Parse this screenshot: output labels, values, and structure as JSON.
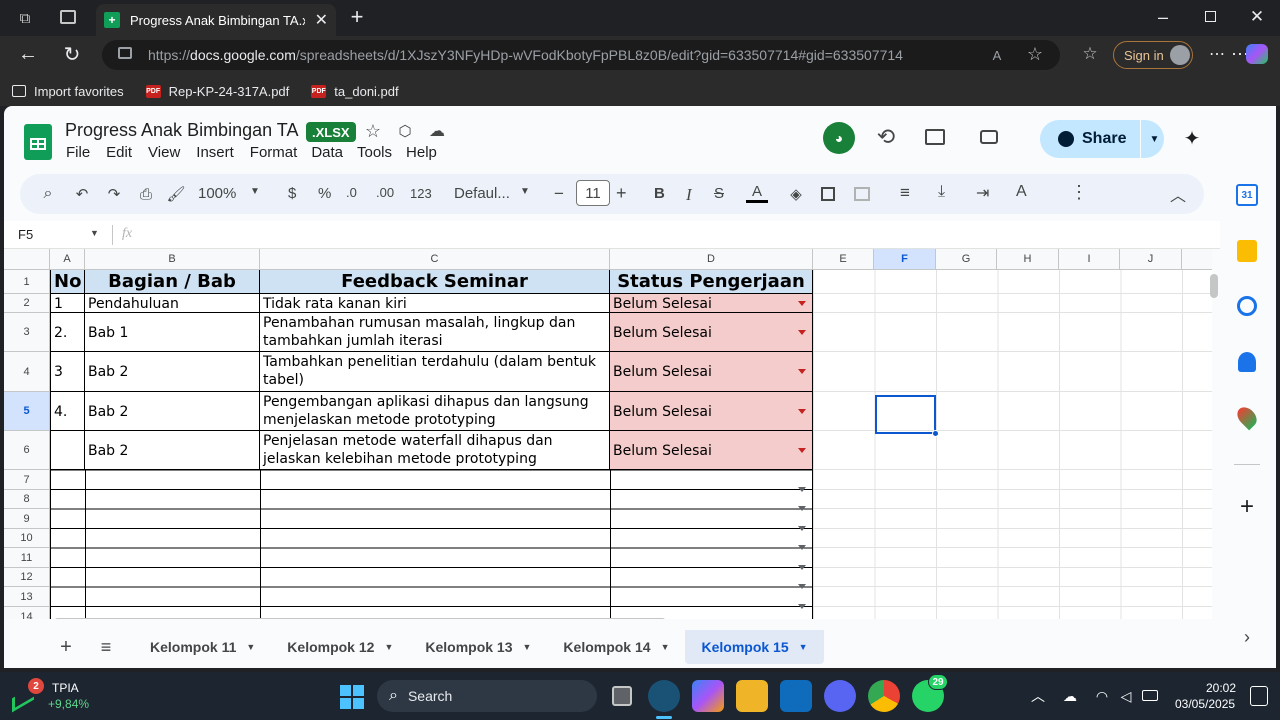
{
  "browser": {
    "tab_title": "Progress Anak Bimbingan TA.xlsx",
    "url_prefix": "https://",
    "url_host": "docs.google.com",
    "url_rest": "/spreadsheets/d/1XJszY3NFyHDp-wVFodKbotyFpPBL8z0B/edit?gid=633507714#gid=633507714",
    "sign_in": "Sign in",
    "favorites": [
      "Import favorites",
      "Rep-KP-24-317A.pdf",
      "ta_doni.pdf"
    ]
  },
  "doc": {
    "title": "Progress Anak Bimbingan TA",
    "badge": ".XLSX",
    "menu": [
      "File",
      "Edit",
      "View",
      "Insert",
      "Format",
      "Data",
      "Tools",
      "Help"
    ],
    "share": "Share"
  },
  "toolbar": {
    "zoom": "100%",
    "currency": "$",
    "percent": "%",
    "dec_less": ".0",
    "dec_more": ".00",
    "num_format": "123",
    "font": "Defaul...",
    "font_size": "11",
    "minus": "−",
    "plus": "+"
  },
  "formula": {
    "cell_ref": "F5",
    "fx": "fx",
    "value": ""
  },
  "columns": [
    "A",
    "B",
    "C",
    "D",
    "E",
    "F",
    "G",
    "H",
    "I",
    "J"
  ],
  "rows": [
    "1",
    "2",
    "3",
    "4",
    "5",
    "6",
    "7",
    "8",
    "9",
    "10",
    "11",
    "12",
    "13",
    "14"
  ],
  "table": {
    "headers": [
      "No",
      "Bagian / Bab",
      "Feedback Seminar",
      "Status Pengerjaan"
    ],
    "data": [
      {
        "no": "1",
        "bab": "Pendahuluan",
        "feedback": "Tidak rata kanan kiri",
        "status": "Belum Selesai"
      },
      {
        "no": "2.",
        "bab": "Bab 1",
        "feedback": "Penambahan rumusan masalah, lingkup dan tambahkan jumlah iterasi",
        "status": "Belum Selesai"
      },
      {
        "no": "3",
        "bab": "Bab 2",
        "feedback": "Tambahkan penelitian terdahulu (dalam bentuk tabel)",
        "status": "Belum Selesai"
      },
      {
        "no": "4.",
        "bab": "Bab 2",
        "feedback": "Pengembangan aplikasi dihapus dan langsung menjelaskan metode prototyping",
        "status": "Belum Selesai"
      },
      {
        "no": "",
        "bab": "Bab 2",
        "feedback": "Penjelasan metode waterfall dihapus dan jelaskan kelebihan metode prototyping",
        "status": "Belum Selesai"
      }
    ]
  },
  "sheets": [
    "Kelompok 11",
    "Kelompok 12",
    "Kelompok 13",
    "Kelompok 14",
    "Kelompok 15"
  ],
  "active_sheet": "Kelompok 15",
  "taskbar": {
    "stock_name": "TPIA",
    "stock_change": "+9,84%",
    "stock_badge": "2",
    "search": "Search",
    "whatsapp_badge": "29",
    "time": "20:02",
    "date": "03/05/2025"
  },
  "colors": {
    "header_fill": "#cfe2f3",
    "status_fill": "#f4cccc",
    "accent": "#0b57d0",
    "share_bg": "#c2e7ff"
  }
}
